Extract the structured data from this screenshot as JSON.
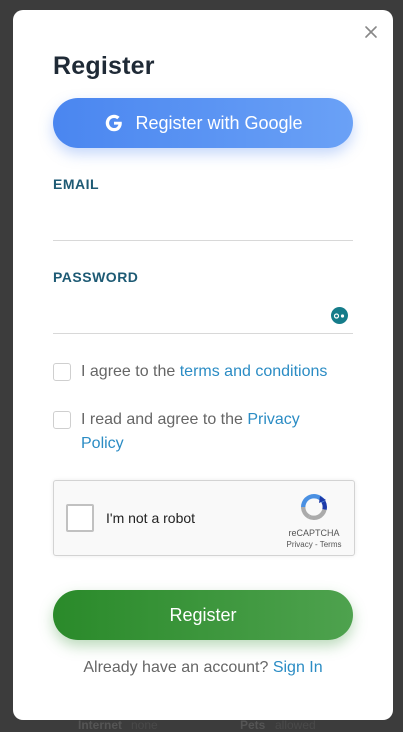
{
  "background": {
    "footer_items": [
      {
        "label": "Internet",
        "value": "none"
      },
      {
        "label": "Pets",
        "value": "allowed"
      }
    ]
  },
  "modal": {
    "title": "Register",
    "close_icon": "close-icon",
    "google_button": {
      "label": "Register with Google",
      "icon": "google-g-icon"
    },
    "email": {
      "label": "EMAIL",
      "value": "",
      "placeholder": ""
    },
    "password": {
      "label": "PASSWORD",
      "value": "",
      "placeholder": "",
      "toggle_icon": "eye-icon"
    },
    "terms": {
      "prefix": "I agree to the ",
      "link": "terms and conditions",
      "checked": false
    },
    "privacy": {
      "prefix": "I read and agree to the ",
      "link": "Privacy Policy",
      "checked": false
    },
    "recaptcha": {
      "label": "I'm not a robot",
      "brand": "reCAPTCHA",
      "privacy": "Privacy",
      "separator": " - ",
      "terms": "Terms",
      "checked": false
    },
    "register_button": {
      "label": "Register"
    },
    "signin": {
      "prompt": "Already have an account? ",
      "link": "Sign In"
    }
  },
  "colors": {
    "google_button": "#4a86f0",
    "register_button": "#2a8a2a",
    "link": "#2b8cc4",
    "field_label": "#1d5a74"
  }
}
